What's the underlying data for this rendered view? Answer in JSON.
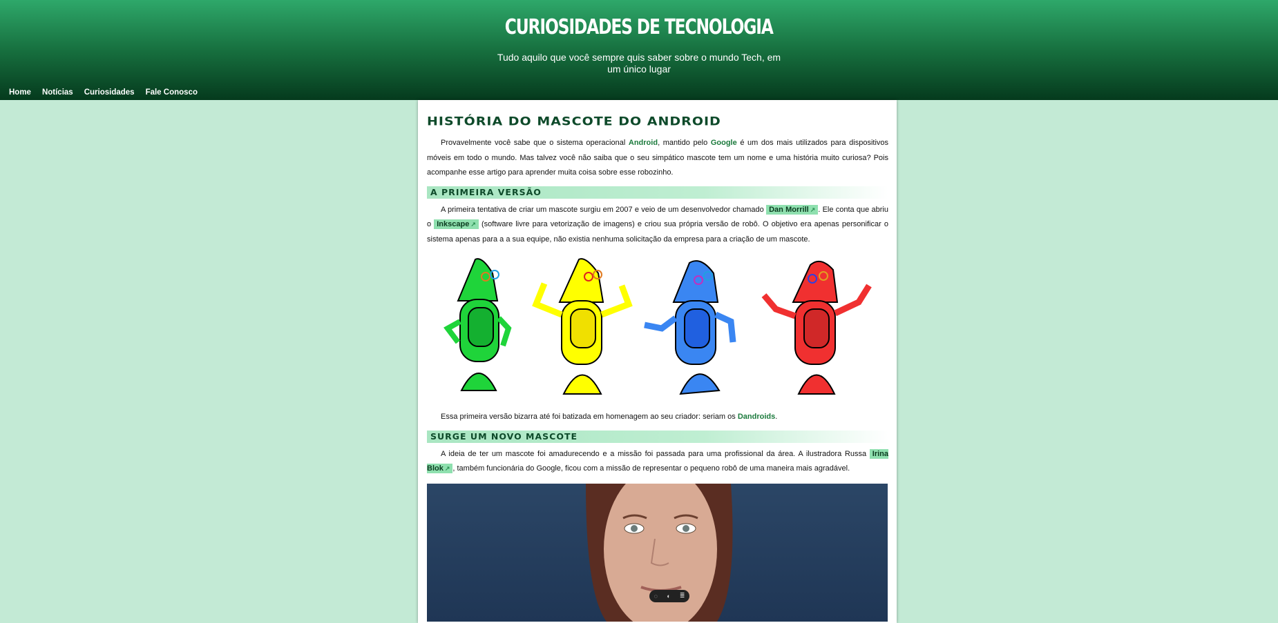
{
  "header": {
    "title": "Curiosidades de Tecnologia",
    "subtitle": "Tudo aquilo que você sempre quis saber sobre o mundo Tech, em um único lugar"
  },
  "nav": {
    "items": [
      {
        "label": "Home"
      },
      {
        "label": "Notícias"
      },
      {
        "label": "Curiosidades"
      },
      {
        "label": "Fale Conosco"
      }
    ]
  },
  "article": {
    "title": "História do mascote do Android",
    "intro": {
      "t1": "Provavelmente você sabe que o sistema operacional ",
      "link1": "Android",
      "t2": ", mantido pelo ",
      "link2": "Google",
      "t3": " é um dos mais utilizados para dispositivos móveis em todo o mundo. Mas talvez você não saiba que o seu simpático mascote tem um nome e uma história muito curiosa? Pois acompanhe esse artigo para aprender muita coisa sobre esse robozinho."
    },
    "section1": {
      "heading": "A primeira versão",
      "t1": "A primeira tentativa de criar um mascote surgiu em 2007 e veio de um desenvolvedor chamado ",
      "link1": "Dan Morrill",
      "t2": ". Ele conta que abriu o ",
      "link2": "Inkscape",
      "t3": " (software livre para vetorização de imagens) e criou sua própria versão de robô. O objetivo era apenas personificar o sistema apenas para a a sua equipe, não existia nenhuma solicitação da empresa para a criação de um mascote.",
      "after_t1": "Essa primeira versão bizarra até foi batizada em homenagem ao seu criador: seriam os ",
      "after_link": "Dandroids",
      "after_t2": "."
    },
    "section2": {
      "heading": "Surge um novo mascote",
      "t1": "A ideia de ter um mascote foi amadurecendo e a missão foi passada para uma profissional da área. A ilustradora Russa ",
      "link1": "Irina Blok",
      "t2": ", também funcionária do Google, ficou com a missão de representar o pequeno robô de uma maneira mais agradável."
    }
  },
  "colors": {
    "robot_green": "#1fd43a",
    "robot_yellow": "#ffff00",
    "robot_blue": "#3a86f2",
    "robot_red": "#f03030",
    "link_highlight": "#8fe0af",
    "page_bg": "#c3ead5"
  },
  "icons": {
    "external_link": "external-link-icon",
    "comment": "comment-icon",
    "contrast": "contrast-icon",
    "menu": "menu-icon"
  }
}
